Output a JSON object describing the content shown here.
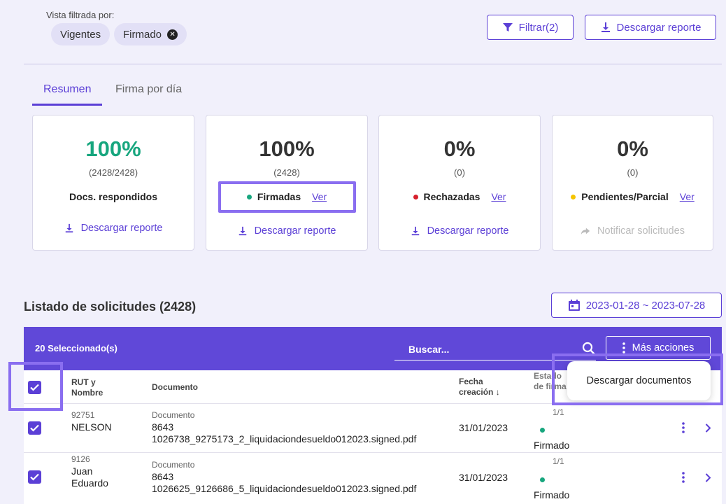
{
  "filters": {
    "caption": "Vista filtrada por:",
    "chips": [
      "Vigentes",
      "Firmado"
    ],
    "filter_button": "Filtrar(2)",
    "download_button": "Descargar reporte"
  },
  "tabs": [
    "Resumen",
    "Firma por día"
  ],
  "cards": [
    {
      "percent": "100%",
      "sub": "(2428/2428)",
      "label": "Docs. respondidos",
      "action": "Descargar reporte"
    },
    {
      "percent": "100%",
      "sub": "(2428)",
      "label": "Firmadas",
      "link": "Ver",
      "action": "Descargar reporte"
    },
    {
      "percent": "0%",
      "sub": "(0)",
      "label": "Rechazadas",
      "link": "Ver",
      "action": "Descargar reporte"
    },
    {
      "percent": "0%",
      "sub": "(0)",
      "label": "Pendientes/Parcial",
      "link": "Ver",
      "action": "Notificar solicitudes"
    }
  ],
  "colors": {
    "accent": "#5b3fd6",
    "green": "#17a67e",
    "red": "#d61f2c",
    "yellow": "#f5c400"
  },
  "list": {
    "title": "Listado de solicitudes (2428)",
    "date_range": "2023-01-28 ~ 2023-07-28",
    "selected": "20 Seleccionado(s)",
    "search_placeholder": "Buscar...",
    "more_actions": "Más acciones",
    "menu_item": "Descargar documentos",
    "headers": {
      "rut_1": "RUT y",
      "rut_2": "Nombre",
      "document": "Documento",
      "date_1": "Fecha",
      "date_2": "creación",
      "status_1": "Estado",
      "status_2": "de firma"
    },
    "rows": [
      {
        "rut": "92751",
        "name_1": "NELSON",
        "name_2": "",
        "doc_label": "Documento",
        "doc_id": "8643",
        "doc_file": "1026738_9275173_2_liquidaciondesueldo012023.signed.pdf",
        "date": "31/01/2023",
        "count": "1/1",
        "status": "Firmado"
      },
      {
        "rut": "9126",
        "name_1": "Juan",
        "name_2": "Eduardo",
        "doc_label": "Documento",
        "doc_id": "8643",
        "doc_file": "1026625_9126686_5_liquidaciondesueldo012023.signed.pdf",
        "date": "31/01/2023",
        "count": "1/1",
        "status": "Firmado"
      }
    ]
  }
}
